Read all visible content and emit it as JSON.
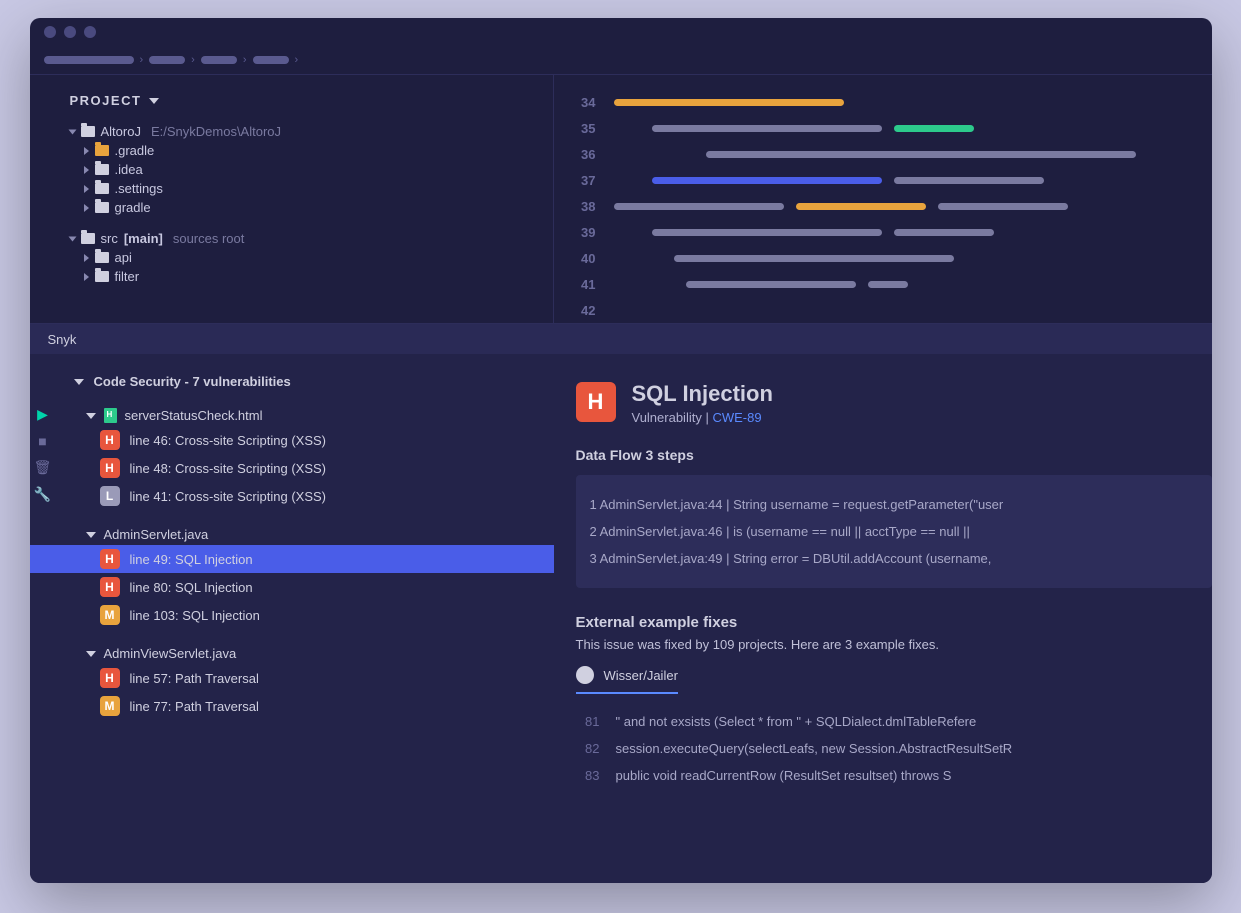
{
  "project": {
    "header": "PROJECT",
    "root": {
      "name": "AltoroJ",
      "path": "E:/SnykDemos\\AltoroJ"
    },
    "folders": [
      {
        "name": ".gradle",
        "orange": true
      },
      {
        "name": ".idea"
      },
      {
        "name": ".settings"
      },
      {
        "name": "gradle"
      }
    ],
    "srcRoot": {
      "name": "src",
      "bracket": "[main]",
      "tail": "sources root"
    },
    "srcChildren": [
      {
        "name": "api"
      },
      {
        "name": "filter"
      }
    ]
  },
  "editor": {
    "startLine": 34,
    "endLine": 42
  },
  "bottomTab": "Snyk",
  "security": {
    "header": "Code Security - 7 vulnerabilities",
    "groups": [
      {
        "file": "serverStatusCheck.html",
        "icon": "html",
        "findings": [
          {
            "sev": "H",
            "text": "line 46: Cross-site Scripting (XSS)"
          },
          {
            "sev": "H",
            "text": "line 48: Cross-site Scripting (XSS)"
          },
          {
            "sev": "L",
            "text": "line 41: Cross-site Scripting (XSS)"
          }
        ]
      },
      {
        "file": "AdminServlet.java",
        "findings": [
          {
            "sev": "H",
            "text": "line 49: SQL Injection",
            "selected": true
          },
          {
            "sev": "H",
            "text": "line 80: SQL Injection"
          },
          {
            "sev": "M",
            "text": "line 103: SQL Injection"
          }
        ]
      },
      {
        "file": "AdminViewServlet.java",
        "findings": [
          {
            "sev": "H",
            "text": "line 57: Path Traversal"
          },
          {
            "sev": "M",
            "text": "line 77: Path Traversal"
          }
        ]
      }
    ]
  },
  "detail": {
    "sev": "H",
    "title": "SQL Injection",
    "subPrefix": "Vulnerability | ",
    "cwe": "CWE-89",
    "flowTitle": "Data Flow 3 steps",
    "flow": [
      "1 AdminServlet.java:44 | String username = request.getParameter(\"user",
      "2 AdminServlet.java:46 | is (username == null || acctType == null ||",
      "3 AdminServlet.java:49 | String error = DBUtil.addAccount (username,"
    ],
    "fixesTitle": "External example fixes",
    "fixesSub": "This issue was fixed by 109 projects. Here are 3 example fixes.",
    "repo": "Wisser/Jailer",
    "fixLines": [
      {
        "n": "81",
        "c": "  \" and not exsists (Select * from \" + SQLDialect.dmlTableRefere"
      },
      {
        "n": "82",
        "c": "session.executeQuery(selectLeafs, new Session.AbstractResultSetR"
      },
      {
        "n": "83",
        "c": "     public void readCurrentRow (ResultSet resultset) throws S"
      }
    ]
  },
  "colors": {
    "o": "#e8a33d",
    "g": "#7a7aa0",
    "t": "#2dca8c",
    "p": "#4a5de8"
  }
}
